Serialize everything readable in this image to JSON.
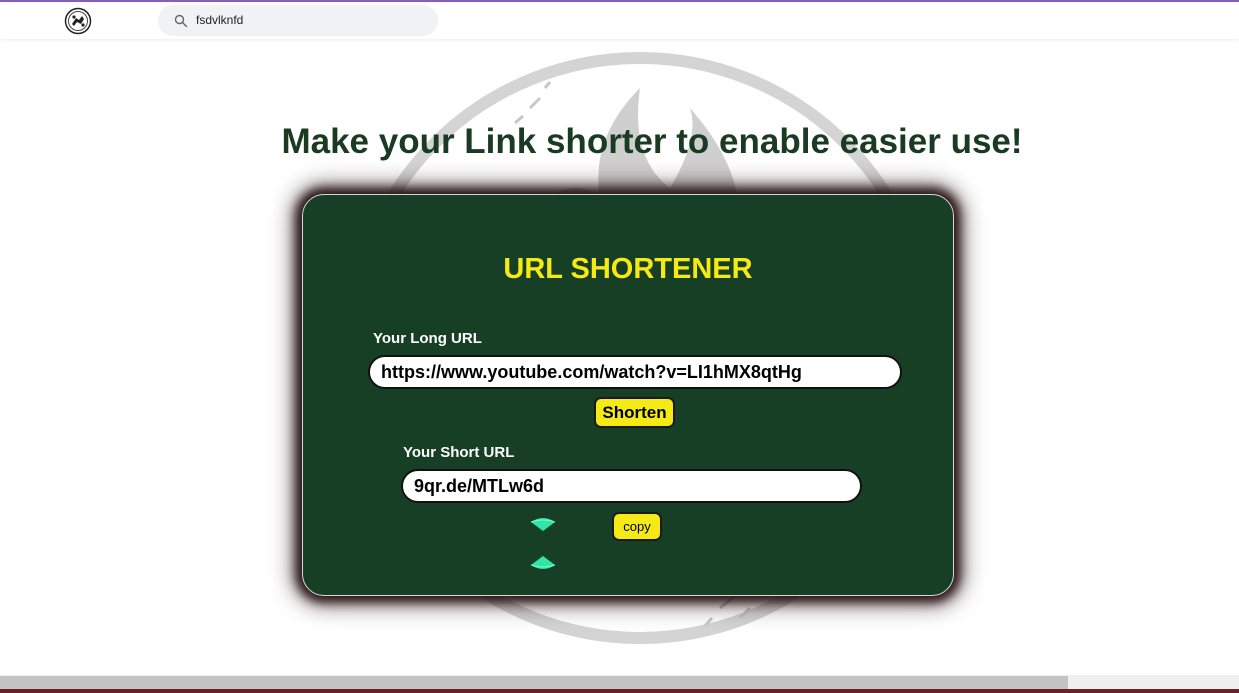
{
  "header": {
    "logo_icon": "chain-link-emblem-icon",
    "search": {
      "value": "fsdvlknfd",
      "icon": "search-icon"
    }
  },
  "page": {
    "headline": "Make your Link shorter to enable easier use!",
    "background_emblem": "flame-emblem-watermark"
  },
  "card": {
    "title": "URL SHORTENER",
    "long_url_label": "Your Long URL",
    "long_url_value": "https://www.youtube.com/watch?v=LI1hMX8qtHg",
    "shorten_label": "Shorten",
    "short_url_label": "Your Short URL",
    "short_url_value": "9qr.de/MTLw6d",
    "copy_label": "copy"
  },
  "colors": {
    "card_background": "#173f25",
    "headline": "#1a3a22",
    "accent_yellow": "#f4ea15",
    "gem_teal": "#2ee6a6",
    "top_accent": "#8a5cc4"
  }
}
